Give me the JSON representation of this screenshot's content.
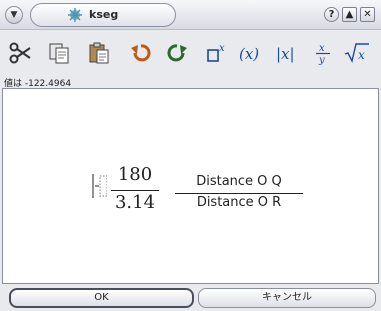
{
  "window": {
    "title": "kseg",
    "menu_glyph": "▼",
    "help_glyph": "?",
    "maximize_glyph": "▲",
    "close_glyph": "✕"
  },
  "toolbar": {
    "items": [
      {
        "name": "cut-icon"
      },
      {
        "name": "copy-icon"
      },
      {
        "name": "paste-icon"
      },
      {
        "name": "undo-icon"
      },
      {
        "name": "redo-icon"
      },
      {
        "name": "superscript-icon"
      },
      {
        "name": "parentheses-icon"
      },
      {
        "name": "absolute-value-icon"
      },
      {
        "name": "fraction-icon"
      },
      {
        "name": "square-root-icon"
      }
    ]
  },
  "value_label": "値は -122.4964",
  "formula": {
    "prefix": "[-",
    "fraction1": {
      "numerator": "180",
      "denominator": "3.14"
    },
    "fraction2": {
      "numerator": "Distance O Q",
      "denominator": "Distance O R"
    }
  },
  "buttons": {
    "ok_label": "OK",
    "cancel_label": "キャンセル"
  },
  "colors": {
    "accent": "#1a4a9c",
    "undo_color": "#c05a18",
    "redo_color": "#2a6a2a"
  }
}
